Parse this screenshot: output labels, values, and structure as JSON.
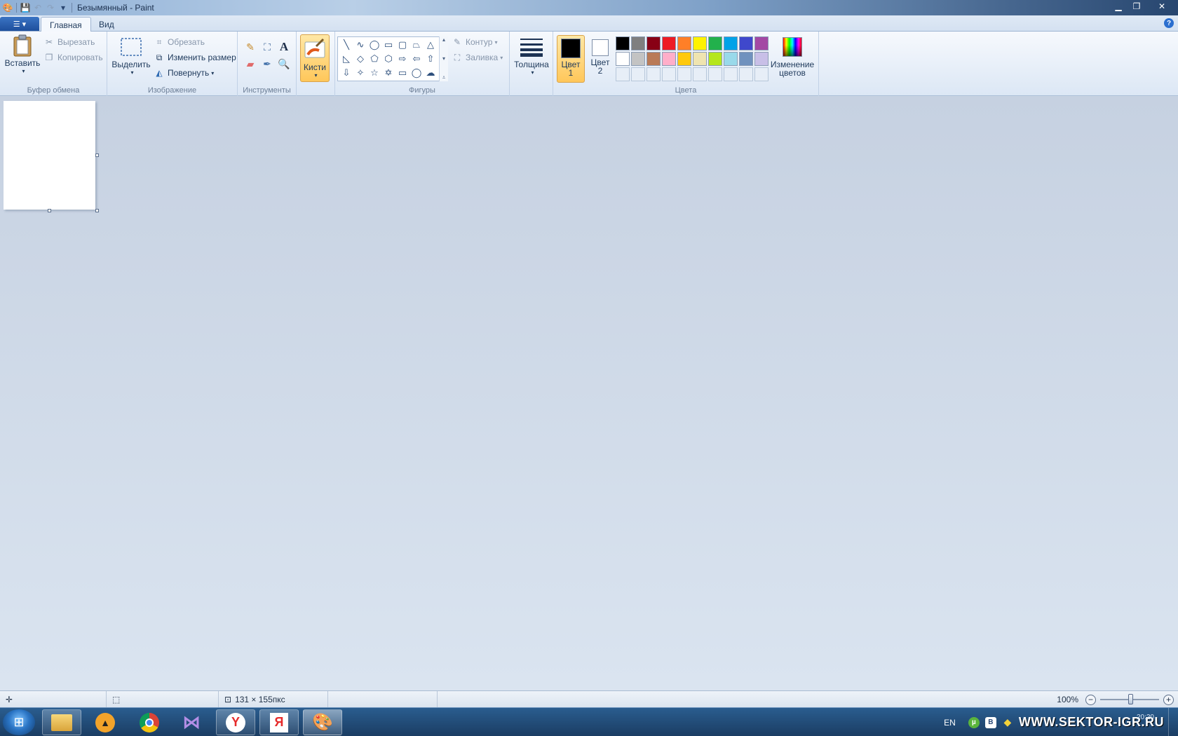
{
  "window": {
    "title": "Безымянный - Paint"
  },
  "tabs": {
    "home": "Главная",
    "view": "Вид"
  },
  "clipboard": {
    "paste": "Вставить",
    "cut": "Вырезать",
    "copy": "Копировать",
    "label": "Буфер обмена"
  },
  "image": {
    "select": "Выделить",
    "crop": "Обрезать",
    "resize": "Изменить размер",
    "rotate": "Повернуть",
    "label": "Изображение"
  },
  "tools": {
    "label": "Инструменты"
  },
  "brushes": {
    "label": "Кисти"
  },
  "shapes": {
    "outline": "Контур",
    "fill": "Заливка",
    "label": "Фигуры"
  },
  "size": {
    "label": "Толщина"
  },
  "colors": {
    "color1": "Цвет 1",
    "color2": "Цвет 2",
    "edit": "Изменение цветов",
    "label": "Цвета",
    "color1_value": "#000000",
    "color2_value": "#ffffff",
    "palette_row1": [
      "#000000",
      "#7f7f7f",
      "#880015",
      "#ed1c24",
      "#ff7f27",
      "#fff200",
      "#22b14c",
      "#00a2e8",
      "#3f48cc",
      "#a349a4"
    ],
    "palette_row2": [
      "#ffffff",
      "#c3c3c3",
      "#b97a57",
      "#ffaec9",
      "#ffc90e",
      "#efe4b0",
      "#b5e61d",
      "#99d9ea",
      "#7092be",
      "#c8bfe7"
    ]
  },
  "status": {
    "dimensions": "131 × 155пкс",
    "zoom": "100%"
  },
  "taskbar": {
    "lang": "EN",
    "watermark": "WWW.SEKTOR-IGR.RU",
    "clock": "20:20"
  }
}
